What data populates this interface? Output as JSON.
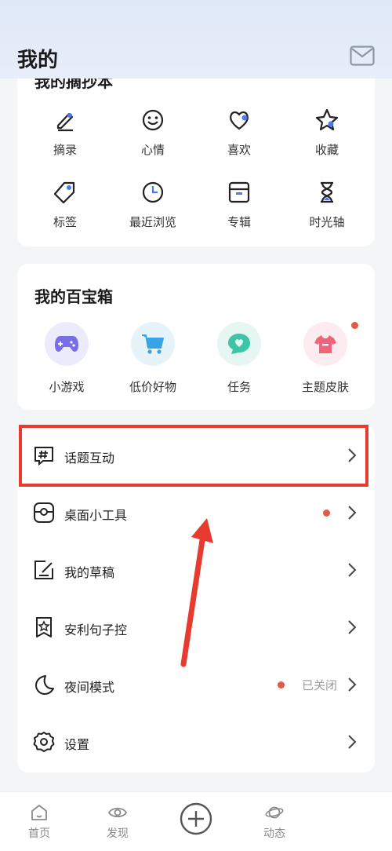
{
  "header": {
    "title": "我的"
  },
  "notes_card": {
    "title": "我的摘抄本",
    "items": [
      {
        "label": "摘录",
        "icon": "pen-icon"
      },
      {
        "label": "心情",
        "icon": "smile-icon"
      },
      {
        "label": "喜欢",
        "icon": "heart-icon"
      },
      {
        "label": "收藏",
        "icon": "star-icon"
      },
      {
        "label": "标签",
        "icon": "tag-icon"
      },
      {
        "label": "最近浏览",
        "icon": "clock-icon"
      },
      {
        "label": "专辑",
        "icon": "album-icon"
      },
      {
        "label": "时光轴",
        "icon": "hourglass-icon"
      }
    ]
  },
  "toolbox": {
    "title": "我的百宝箱",
    "items": [
      {
        "label": "小游戏",
        "icon": "gamepad-icon",
        "bg": "#ecebfb"
      },
      {
        "label": "低价好物",
        "icon": "cart-icon",
        "bg": "#e6f4fa"
      },
      {
        "label": "任务",
        "icon": "task-bubble-icon",
        "bg": "#e6f6f2"
      },
      {
        "label": "主题皮肤",
        "icon": "shirt-icon",
        "bg": "#fdecef"
      }
    ]
  },
  "menu": {
    "items": [
      {
        "label": "话题互动",
        "icon": "hashtag-icon"
      },
      {
        "label": "桌面小工具",
        "icon": "widget-icon"
      },
      {
        "label": "我的草稿",
        "icon": "draft-icon"
      },
      {
        "label": "安利句子控",
        "icon": "bookmark-star-icon"
      },
      {
        "label": "夜间模式",
        "icon": "moon-icon",
        "status": "已关闭"
      },
      {
        "label": "设置",
        "icon": "gear-icon"
      }
    ]
  },
  "bottom_nav": {
    "items": [
      {
        "label": "首页",
        "icon": "home-icon"
      },
      {
        "label": "发现",
        "icon": "eye-icon"
      },
      {
        "label": "",
        "icon": "plus-circle-icon"
      },
      {
        "label": "动态",
        "icon": "planet-icon"
      }
    ]
  },
  "colors": {
    "accent": "#4a7bea",
    "badge": "#e05a4a",
    "highlight": "#e63b2e"
  }
}
